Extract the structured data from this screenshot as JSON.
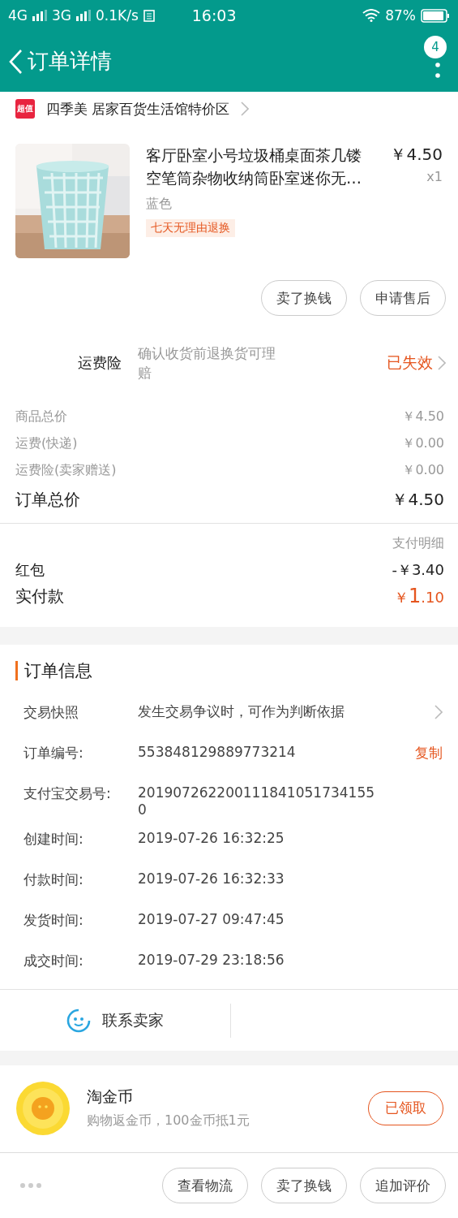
{
  "status_bar": {
    "network": "4G",
    "network2": "3G",
    "speed": "0.1K/s",
    "time": "16:03",
    "battery": "87%"
  },
  "header": {
    "title": "订单详情",
    "badge": "4"
  },
  "shop": {
    "badge": "超值",
    "name": "四季美 居家百货生活馆特价区"
  },
  "product": {
    "title": "客厅卧室小号垃圾桶桌面茶几镂空笔筒杂物收纳筒卧室迷你无…",
    "price": "￥4.50",
    "qty": "x1",
    "variant": "蓝色",
    "tag": "七天无理由退换",
    "actions": [
      "卖了换钱",
      "申请售后"
    ]
  },
  "insurance": {
    "label": "运费险",
    "desc": "确认收货前退换货可理赔",
    "status": "已失效"
  },
  "fees": [
    {
      "label": "商品总价",
      "value": "￥4.50",
      "kind": "minor"
    },
    {
      "label": "运费(快递)",
      "value": "￥0.00",
      "kind": "minor"
    },
    {
      "label": "运费险(卖家赠送)",
      "value": "￥0.00",
      "kind": "minor"
    },
    {
      "label": "订单总价",
      "value": "￥4.50",
      "kind": "total"
    }
  ],
  "payment": {
    "link": "支付明细",
    "discount": {
      "label": "红包",
      "value": "-￥3.40"
    },
    "paid": {
      "label": "实付款",
      "currency": "￥",
      "integer": "1",
      "fraction": ".10"
    }
  },
  "order_info": {
    "title": "订单信息",
    "rows": [
      {
        "label": "交易快照",
        "value": "发生交易争议时，可作为判断依据",
        "kind": "link"
      },
      {
        "label": "订单编号:",
        "value": "553848129889773214",
        "action": "复制",
        "kind": "copy"
      },
      {
        "label": "支付宝交易号:",
        "value": "2019072622001118410517341550",
        "kind": "plain"
      },
      {
        "label": "创建时间:",
        "value": "2019-07-26 16:32:25",
        "kind": "plain"
      },
      {
        "label": "付款时间:",
        "value": "2019-07-26 16:32:33",
        "kind": "plain"
      },
      {
        "label": "发货时间:",
        "value": "2019-07-27 09:47:45",
        "kind": "plain"
      },
      {
        "label": "成交时间:",
        "value": "2019-07-29 23:18:56",
        "kind": "plain"
      }
    ]
  },
  "contact": {
    "label": "联系卖家"
  },
  "coins": {
    "title": "淘金币",
    "subtitle": "购物返金币，100金币抵1元",
    "button": "已领取"
  },
  "bottom_bar": {
    "buttons": [
      "查看物流",
      "卖了换钱",
      "追加评价"
    ]
  }
}
